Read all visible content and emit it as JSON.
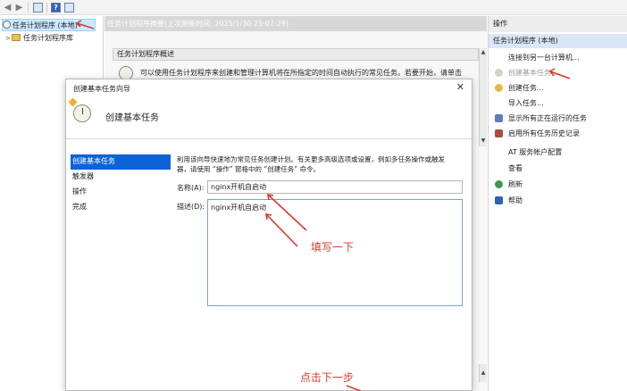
{
  "toolbar": {
    "back_icon": "back-arrow-icon",
    "forward_icon": "forward-arrow-icon",
    "help_glyph": "?"
  },
  "tree": {
    "root": "任务计划程序 (本地)",
    "library": "任务计划程序库"
  },
  "center": {
    "header": "任务计划程序摘要(上次刷新时间: 2025/1/30 23:07:29)",
    "section_title": "任务计划程序概述",
    "overview_text": "可以使用任务计划程序来创建和管理计算机将在所指定的时间自动执行的常见任务。若要开始，请单击"
  },
  "actions": {
    "header": "操作",
    "group": "任务计划程序 (本地)",
    "items": [
      {
        "label": "连接到另一台计算机...",
        "disabled": false
      },
      {
        "label": "创建基本任务...",
        "disabled": true
      },
      {
        "label": "创建任务...",
        "disabled": false
      },
      {
        "label": "导入任务...",
        "disabled": false
      },
      {
        "label": "显示所有正在运行的任务",
        "disabled": false
      },
      {
        "label": "启用所有任务历史记录",
        "disabled": false
      },
      {
        "label": "AT 服务帐户配置",
        "disabled": false
      },
      {
        "label": "查看",
        "disabled": false
      },
      {
        "label": "刷新",
        "disabled": false
      },
      {
        "label": "帮助",
        "disabled": false
      }
    ]
  },
  "dialog": {
    "title": "创建基本任务向导",
    "heading": "创建基本任务",
    "steps": [
      "创建基本任务",
      "触发器",
      "操作",
      "完成"
    ],
    "active_step": 0,
    "description_line1": "利用该向导快速地为常见任务创建计划。有关更多高级选项或设置，例如多任务操作或触发",
    "description_line2": "器，请使用 “操作” 窗格中的 “创建任务” 命令。",
    "name_label": "名称(A):",
    "name_value": "nginx开机自启动",
    "desc_label": "描述(D):",
    "desc_value": "nginx开机自启动"
  },
  "annotations": {
    "fill_in": "填写一下",
    "click_next": "点击下一步"
  },
  "colors": {
    "annotation_red": "#d63b2a",
    "selection_blue": "#0a64d8",
    "group_bg": "#d9e6f5"
  }
}
